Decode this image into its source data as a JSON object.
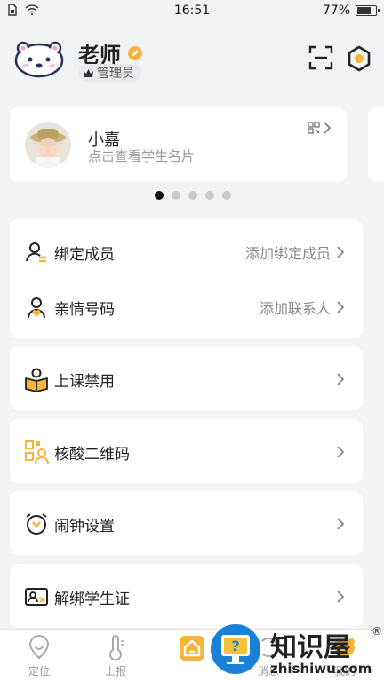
{
  "status_bar": {
    "time": "16:51",
    "battery": "77%",
    "battery_level": 0.77
  },
  "header": {
    "name": "老师",
    "role": "管理员"
  },
  "student_card": {
    "name": "小嘉",
    "hint": "点击查看学生名片"
  },
  "carousel": {
    "pages": 5,
    "active": 0
  },
  "menu_groups": [
    [
      {
        "id": "bind-member",
        "icon": "person-add-icon",
        "label": "绑定成员",
        "value": "添加绑定成员"
      },
      {
        "id": "family-number",
        "icon": "person-heart-icon",
        "label": "亲情号码",
        "value": "添加联系人"
      }
    ],
    [
      {
        "id": "class-disable",
        "icon": "book-reader-icon",
        "label": "上课禁用",
        "value": ""
      }
    ],
    [
      {
        "id": "nucleic-qr",
        "icon": "qr-person-icon",
        "label": "核酸二维码",
        "value": ""
      }
    ],
    [
      {
        "id": "alarm",
        "icon": "alarm-clock-icon",
        "label": "闹钟设置",
        "value": ""
      }
    ],
    [
      {
        "id": "unbind-card",
        "icon": "id-card-icon",
        "label": "解绑学生证",
        "value": ""
      }
    ]
  ],
  "tabs": [
    {
      "id": "location",
      "label": "定位",
      "icon": "location-pin-icon"
    },
    {
      "id": "report",
      "label": "上报",
      "icon": "thermometer-icon"
    },
    {
      "id": "home",
      "label": "",
      "icon": "home-icon"
    },
    {
      "id": "message",
      "label": "消息",
      "icon": "message-icon"
    },
    {
      "id": "mine",
      "label": "我的",
      "icon": "bear-icon"
    }
  ],
  "watermark": {
    "text": "知识屋",
    "url": "zhishiwu.com",
    "reg": "®"
  },
  "colors": {
    "accent": "#f3b53a",
    "icon_dark": "#222222",
    "text_muted": "#888888"
  }
}
